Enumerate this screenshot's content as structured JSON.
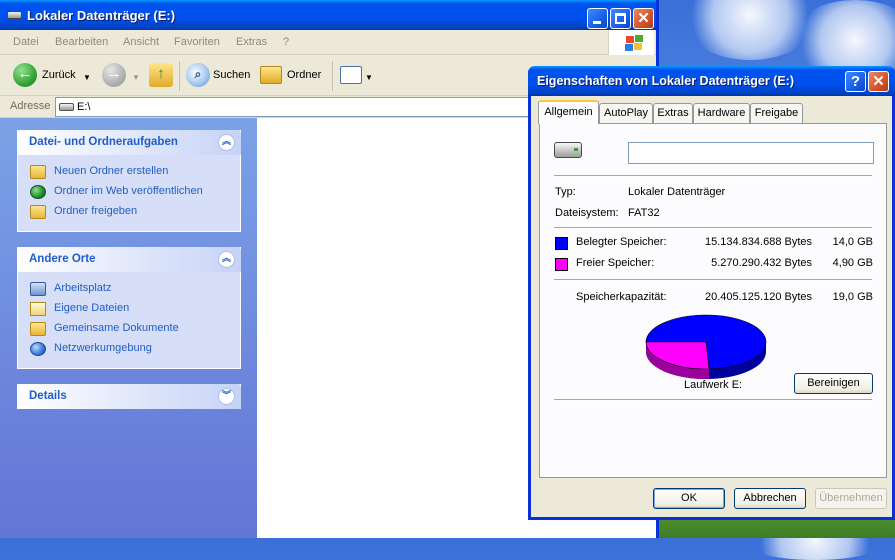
{
  "explorer": {
    "title": "Lokaler Datenträger (E:)",
    "menu": [
      "Datei",
      "Bearbeiten",
      "Ansicht",
      "Favoriten",
      "Extras",
      "?"
    ],
    "toolbar": {
      "back_label": "Zurück",
      "search_label": "Suchen",
      "folders_label": "Ordner"
    },
    "address": {
      "label": "Adresse",
      "value": "E:\\"
    },
    "taskpane": {
      "file_tasks": {
        "title": "Datei- und Ordneraufgaben",
        "items": [
          {
            "label": "Neuen Ordner erstellen",
            "icon": "new-folder-icon"
          },
          {
            "label": "Ordner im Web veröffentlichen",
            "icon": "publish-web-icon"
          },
          {
            "label": "Ordner freigeben",
            "icon": "share-folder-icon"
          }
        ]
      },
      "other_places": {
        "title": "Andere Orte",
        "items": [
          {
            "label": "Arbeitsplatz",
            "icon": "my-computer-icon"
          },
          {
            "label": "Eigene Dateien",
            "icon": "my-documents-icon"
          },
          {
            "label": "Gemeinsame Dokumente",
            "icon": "shared-documents-icon"
          },
          {
            "label": "Netzwerkumgebung",
            "icon": "network-places-icon"
          }
        ]
      },
      "details": {
        "title": "Details"
      }
    }
  },
  "dialog": {
    "title": "Eigenschaften von Lokaler Datenträger (E:)",
    "help_label": "?",
    "tabs": [
      "Allgemein",
      "AutoPlay",
      "Extras",
      "Hardware",
      "Freigabe"
    ],
    "active_tab": "Allgemein",
    "general": {
      "name_value": "",
      "type_label": "Typ:",
      "type_value": "Lokaler Datenträger",
      "fs_label": "Dateisystem:",
      "fs_value": "FAT32",
      "used": {
        "label": "Belegter Speicher:",
        "bytes": "15.134.834.688 Bytes",
        "size": "14,0 GB",
        "color": "#0000ff"
      },
      "free": {
        "label": "Freier Speicher:",
        "bytes": "5.270.290.432 Bytes",
        "size": "4,90 GB",
        "color": "#ff00ff"
      },
      "capacity": {
        "label": "Speicherkapazität:",
        "bytes": "20.405.125.120 Bytes",
        "size": "19,0 GB"
      },
      "used_fraction": 0.742,
      "drive_label": "Laufwerk E:",
      "cleanup_label": "Bereinigen"
    },
    "buttons": {
      "ok": "OK",
      "cancel": "Abbrechen",
      "apply": "Übernehmen"
    }
  }
}
